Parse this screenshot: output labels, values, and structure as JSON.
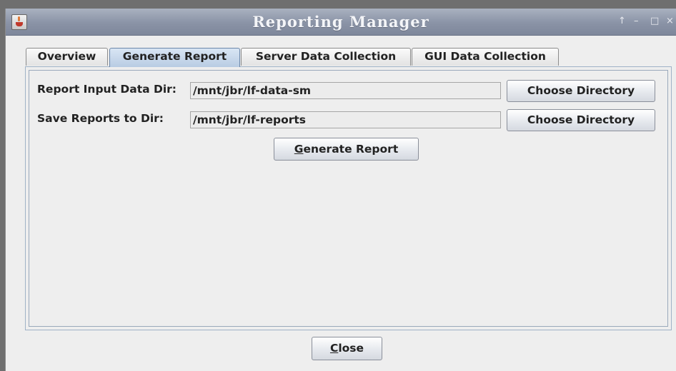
{
  "window": {
    "title": "Reporting Manager",
    "controls": {
      "pin": "↑",
      "minimize": "–",
      "maximize": "□",
      "close": "×"
    }
  },
  "tabs": [
    {
      "label": "Overview",
      "active": false
    },
    {
      "label": "Generate Report",
      "active": true
    },
    {
      "label": "Server Data Collection",
      "active": false
    },
    {
      "label": "GUI Data Collection",
      "active": false
    }
  ],
  "form": {
    "input_dir": {
      "label": "Report Input Data Dir:",
      "value": "/mnt/jbr/lf-data-sm",
      "button_label": "Choose Directory"
    },
    "save_dir": {
      "label": "Save Reports to Dir:",
      "value": "/mnt/jbr/lf-reports",
      "button_label": "Choose Directory"
    },
    "generate_button": {
      "mnemonic": "G",
      "rest": "enerate Report"
    }
  },
  "footer": {
    "close_button": {
      "mnemonic": "C",
      "rest": "lose"
    }
  },
  "colors": {
    "titlebar": "#8a93a6",
    "window_bg": "#eeeeee",
    "active_tab": "#b8cce3"
  }
}
